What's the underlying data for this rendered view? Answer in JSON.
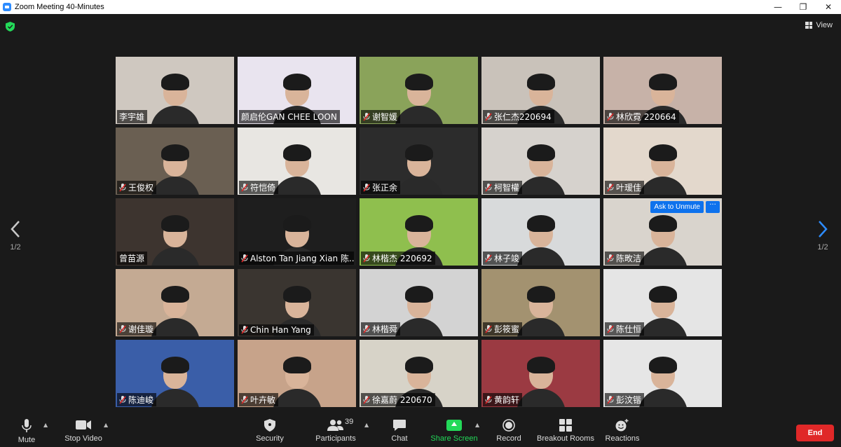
{
  "window": {
    "title": "Zoom Meeting 40-Minutes"
  },
  "view_label": "View",
  "pagination": {
    "left": "1/2",
    "right": "1/2"
  },
  "tile_overlay": {
    "ask_unmute": "Ask to Unmute",
    "more": "···"
  },
  "participants": [
    {
      "name": "李宇雄",
      "muted": false,
      "bg": "#cfc8c0"
    },
    {
      "name": "颜启伦GAN CHEE LOON",
      "muted": false,
      "bg": "#e9e4ef",
      "active": true
    },
    {
      "name": "谢智媛",
      "muted": true,
      "bg": "#8aa35a"
    },
    {
      "name": "张仁杰220694",
      "muted": true,
      "bg": "#c9c2ba"
    },
    {
      "name": "林欣霓 220664",
      "muted": true,
      "bg": "#c7b2a8"
    },
    {
      "name": "王俊权",
      "muted": true,
      "bg": "#6a5f52"
    },
    {
      "name": "符恺倚",
      "muted": true,
      "bg": "#e8e6e2"
    },
    {
      "name": "张正余",
      "muted": true,
      "bg": "#2c2c2c"
    },
    {
      "name": "柯智權",
      "muted": true,
      "bg": "#d6d2cd"
    },
    {
      "name": "叶瑷佳",
      "muted": true,
      "bg": "#e3d8cc"
    },
    {
      "name": "曾苗源",
      "muted": false,
      "bg": "#3d342f"
    },
    {
      "name": "Alston Tan Jiang Xian 陈...",
      "muted": true,
      "bg": "#1e1e1e"
    },
    {
      "name": "林楷杰 220692",
      "muted": true,
      "bg": "#8fbf4e"
    },
    {
      "name": "林子竣",
      "muted": true,
      "bg": "#d8dadb"
    },
    {
      "name": "陈畋洁",
      "muted": true,
      "bg": "#d9d4cd",
      "ask_unmute": true
    },
    {
      "name": "谢佳璇",
      "muted": true,
      "bg": "#c4aa93"
    },
    {
      "name": "Chin Han Yang",
      "muted": true,
      "bg": "#3a3530"
    },
    {
      "name": "林楷舜",
      "muted": true,
      "bg": "#d3d3d3"
    },
    {
      "name": "彭筱蜜",
      "muted": true,
      "bg": "#a39270"
    },
    {
      "name": "陈仕恒",
      "muted": true,
      "bg": "#e5e5e5"
    },
    {
      "name": "陈迪峻",
      "muted": true,
      "bg": "#3a5ea8"
    },
    {
      "name": "叶卉敏",
      "muted": true,
      "bg": "#c7a38a"
    },
    {
      "name": "徐嘉蔚 220670",
      "muted": true,
      "bg": "#d7d3c8"
    },
    {
      "name": "黄韵轩",
      "muted": true,
      "bg": "#9b3a42"
    },
    {
      "name": "彭汶锴",
      "muted": true,
      "bg": "#e6e6e6"
    }
  ],
  "toolbar": {
    "mute": "Mute",
    "stop_video": "Stop Video",
    "security": "Security",
    "participants": "Participants",
    "participants_count": "39",
    "chat": "Chat",
    "share_screen": "Share Screen",
    "record": "Record",
    "breakout_rooms": "Breakout Rooms",
    "reactions": "Reactions",
    "end": "End"
  },
  "colors": {
    "share_green": "#23d959",
    "end_red": "#e02828",
    "ask_blue": "#0e72ed",
    "shield_green": "#23d959"
  }
}
